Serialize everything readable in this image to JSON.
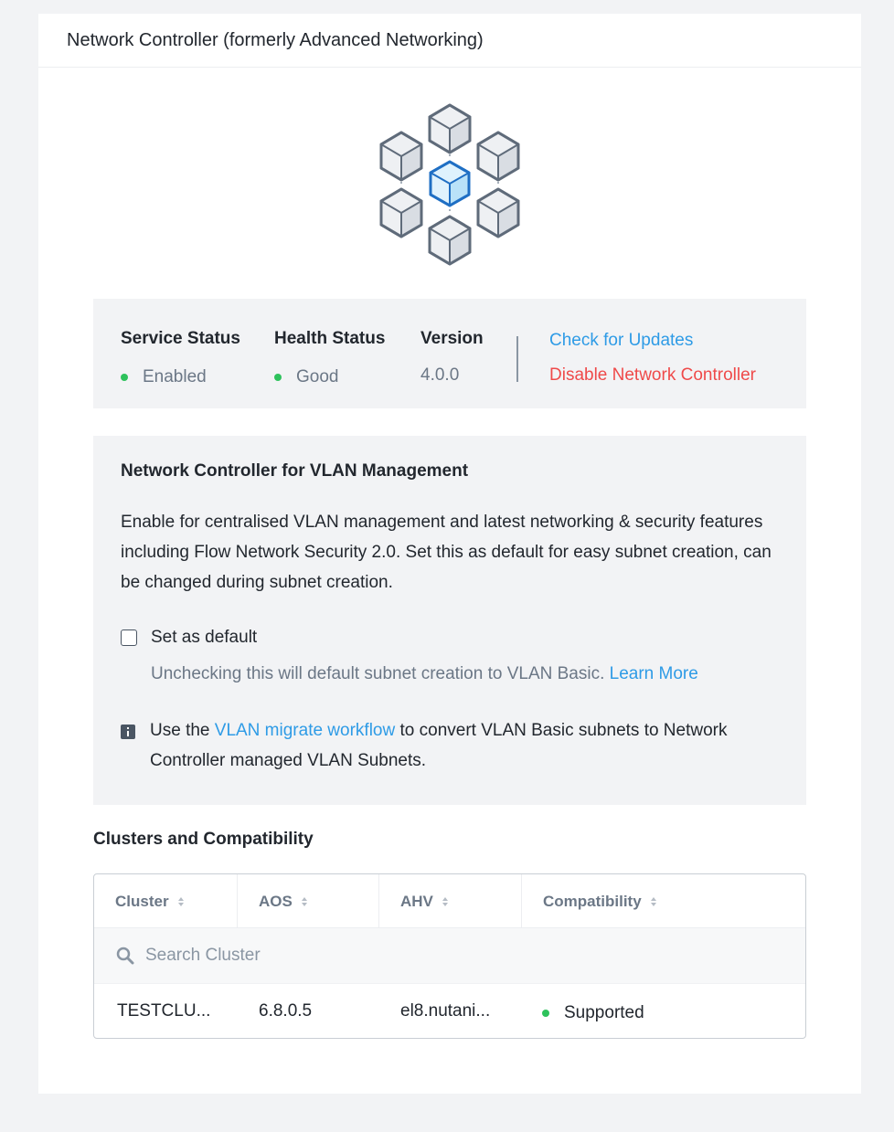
{
  "panel": {
    "title": "Network Controller (formerly Advanced Networking)"
  },
  "status": {
    "service_status_label": "Service Status",
    "service_status_value": "Enabled",
    "health_status_label": "Health Status",
    "health_status_value": "Good",
    "version_label": "Version",
    "version_value": "4.0.0",
    "check_updates": "Check for Updates",
    "disable": "Disable Network Controller",
    "status_color": "#2ec25c"
  },
  "vlan": {
    "title": "Network Controller for VLAN Management",
    "description": "Enable for centralised VLAN management and latest networking & security features including Flow Network Security 2.0. Set this as default for easy subnet creation, can be changed during subnet creation.",
    "set_default_label": "Set as default",
    "set_default_checked": false,
    "help_text": "Unchecking this will default subnet creation to VLAN Basic.",
    "learn_more": "Learn More",
    "info_prefix": "Use the",
    "info_link": "VLAN migrate workflow",
    "info_suffix": "to convert VLAN Basic subnets to Network Controller managed VLAN Subnets."
  },
  "clusters": {
    "title": "Clusters and Compatibility",
    "columns": [
      "Cluster",
      "AOS",
      "AHV",
      "Compatibility"
    ],
    "search_placeholder": "Search Cluster",
    "rows": [
      {
        "cluster": "TESTCLU...",
        "aos": "6.8.0.5",
        "ahv": "el8.nutani...",
        "compatibility": "Supported"
      }
    ]
  },
  "colors": {
    "link": "#2e9be6",
    "danger": "#ef4a4a",
    "accent_cube": "#1f6fc4"
  }
}
